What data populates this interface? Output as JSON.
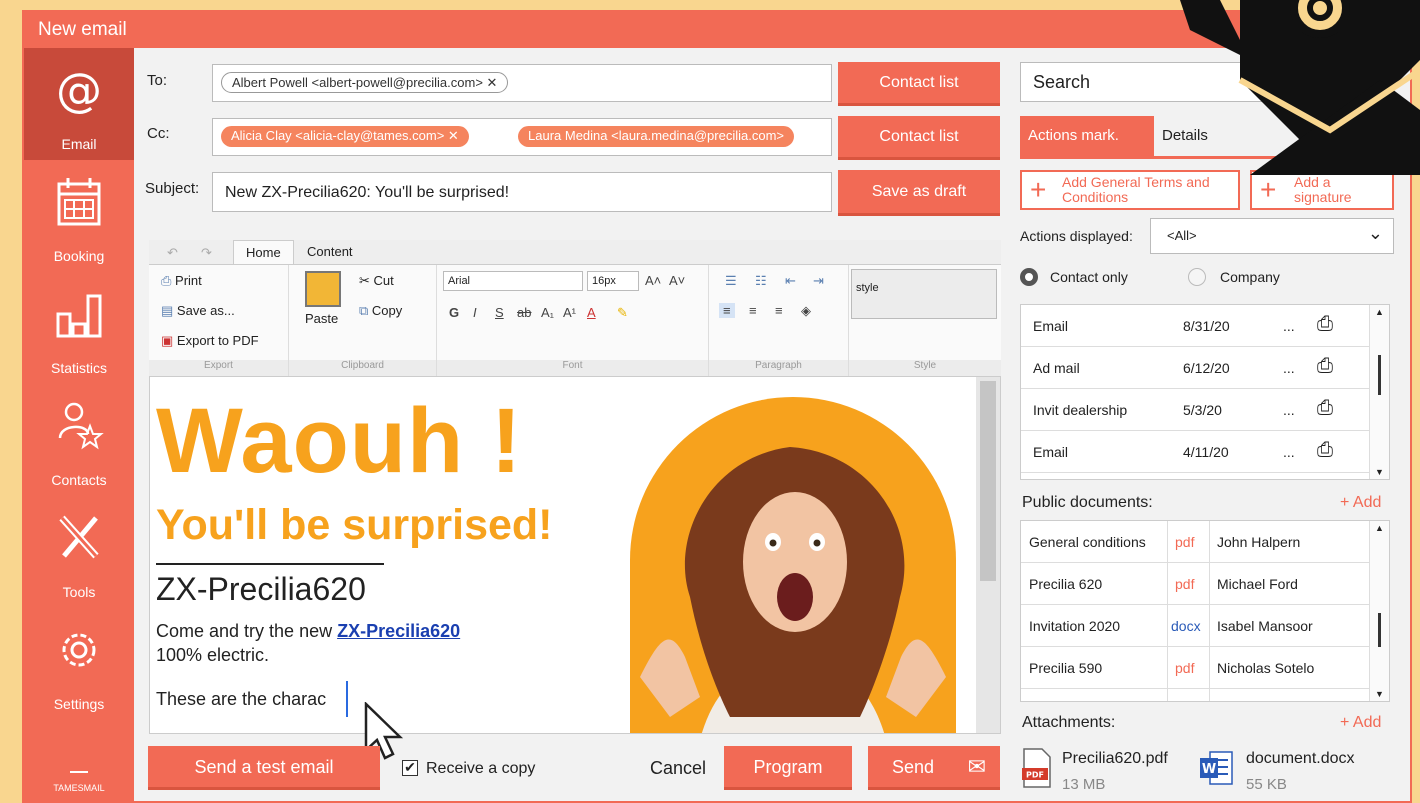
{
  "window": {
    "title": "New email"
  },
  "sidebar": {
    "items": [
      {
        "label": "Email",
        "icon": "at-icon"
      },
      {
        "label": "Booking",
        "icon": "calendar-icon"
      },
      {
        "label": "Statistics",
        "icon": "bar-chart-icon"
      },
      {
        "label": "Contacts",
        "icon": "contacts-icon"
      },
      {
        "label": "Tools",
        "icon": "tools-icon"
      },
      {
        "label": "Settings",
        "icon": "gear-icon"
      }
    ],
    "brand": "TAMESMAIL"
  },
  "compose": {
    "to_label": "To:",
    "to_chips": [
      "Albert Powell <albert-powell@precilia.com> ✕"
    ],
    "cc_label": "Cc:",
    "cc_chips": [
      "Alicia Clay <alicia-clay@tames.com>  ✕",
      "Laura Medina <laura.medina@precilia.com>"
    ],
    "subject_label": "Subject:",
    "subject_value": "New ZX-Precilia620: You'll be surprised!",
    "contact_list": "Contact list",
    "save_draft": "Save as draft"
  },
  "ribbon": {
    "tabs": [
      "Home",
      "Content"
    ],
    "export": {
      "print": "Print",
      "save_as": "Save as...",
      "export_pdf": "Export to PDF",
      "group": "Export"
    },
    "clipboard": {
      "paste": "Paste",
      "cut": "Cut",
      "copy": "Copy",
      "group": "Clipboard"
    },
    "font": {
      "family": "Arial",
      "size": "16px",
      "group": "Font",
      "bold": "G",
      "italic": "I",
      "underline": "S"
    },
    "paragraph": {
      "group": "Paragraph"
    },
    "style": {
      "value": "style",
      "group": "Style"
    }
  },
  "editor": {
    "headline": "Waouh !",
    "subhead": "You'll be surprised!",
    "model": "ZX-Precilia620",
    "line1_prefix": "Come and try the new ",
    "line1_link": "ZX-Precilia620",
    "line2": "100% electric.",
    "line3": "These are the charac"
  },
  "footer": {
    "test_email": "Send a test email",
    "receive_copy": "Receive a copy",
    "cancel": "Cancel",
    "program": "Program",
    "send": "Send"
  },
  "right": {
    "search_placeholder": "Search",
    "tab_actions": "Actions mark.",
    "tab_details": "Details",
    "add_terms": "Add General Terms and Conditions",
    "add_signature": "Add a signature",
    "actions_displayed_label": "Actions displayed:",
    "actions_displayed_value": "<All>",
    "radio_contact": "Contact only",
    "radio_company": "Company",
    "actions": [
      {
        "name": "Email",
        "date": "8/31/20"
      },
      {
        "name": "Ad mail",
        "date": "6/12/20"
      },
      {
        "name": "Invit dealership",
        "date": "5/3/20"
      },
      {
        "name": "Email",
        "date": "4/11/20"
      }
    ],
    "more": "...",
    "public_docs_label": "Public documents:",
    "add": "+ Add",
    "documents": [
      {
        "name": "General conditions",
        "type": "pdf",
        "owner": "John Halpern"
      },
      {
        "name": "Precilia 620",
        "type": "pdf",
        "owner": "Michael Ford"
      },
      {
        "name": "Invitation 2020",
        "type": "docx",
        "owner": "Isabel Mansoor"
      },
      {
        "name": "Precilia 590",
        "type": "pdf",
        "owner": "Nicholas Sotelo"
      }
    ],
    "attachments_label": "Attachments:",
    "attachments": [
      {
        "name": "Precilia620.pdf",
        "size": "13 MB"
      },
      {
        "name": "document.docx",
        "size": "55 KB"
      }
    ]
  },
  "colors": {
    "accent": "#f26a55",
    "headline": "#f7a21d",
    "background": "#f9d68f"
  }
}
